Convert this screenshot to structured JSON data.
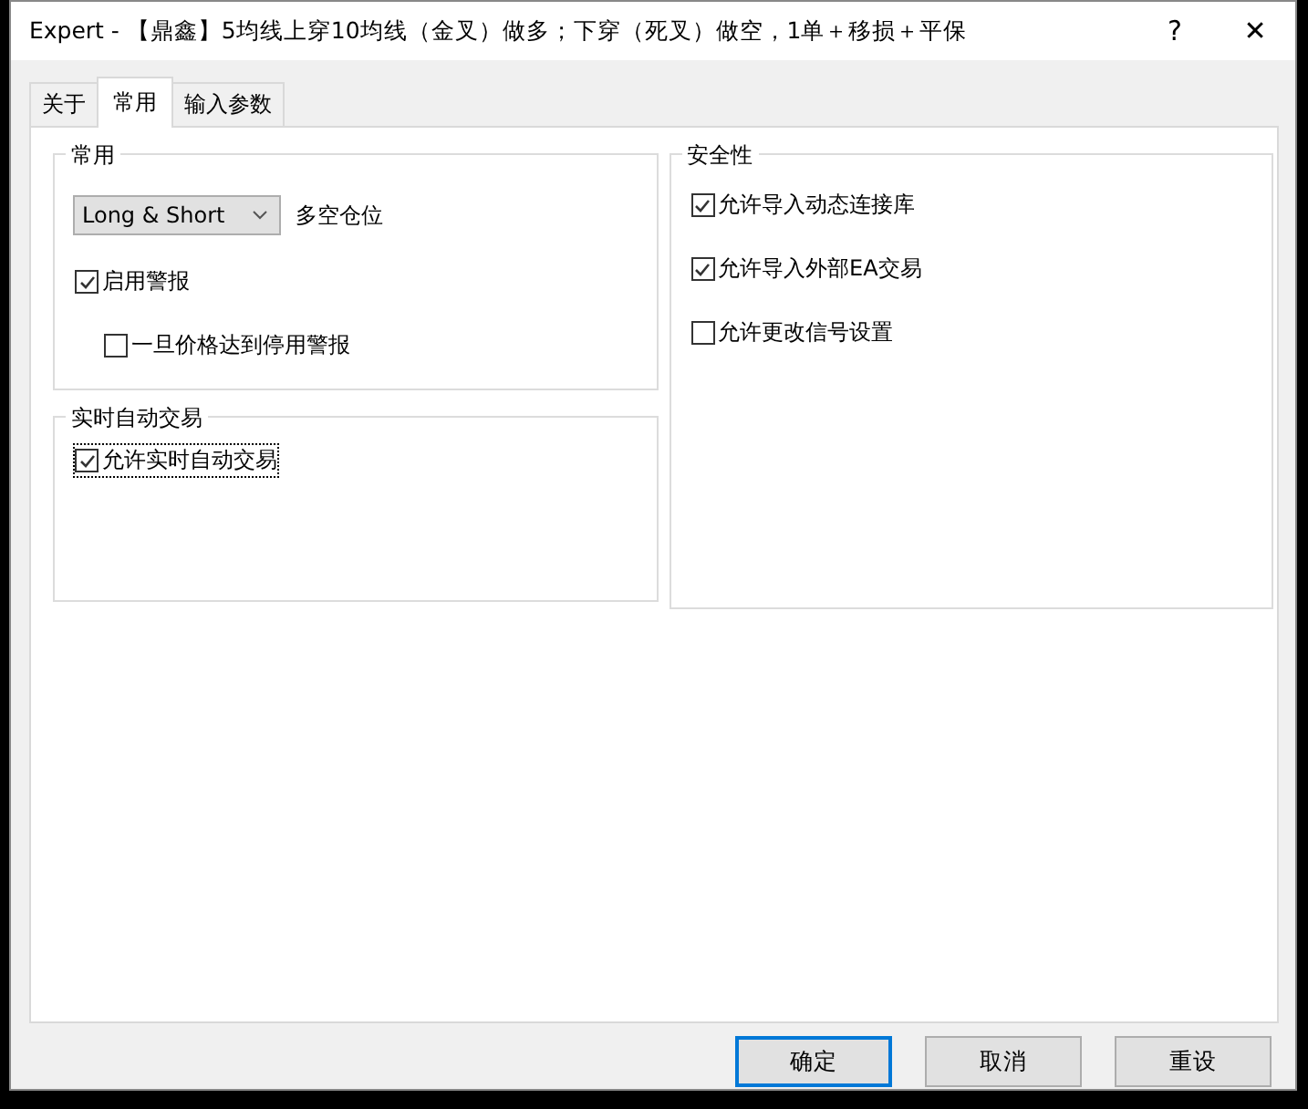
{
  "window": {
    "title": "Expert - 【鼎鑫】5均线上穿10均线（金叉）做多；下穿（死叉）做空，1单＋移损＋平保",
    "help": "?",
    "close": "✕"
  },
  "tabs": [
    {
      "label": "关于",
      "selected": false
    },
    {
      "label": "常用",
      "selected": true
    },
    {
      "label": "输入参数",
      "selected": false
    }
  ],
  "left_groups": [
    {
      "title": "常用",
      "items": [
        {
          "kind": "dropdown",
          "value": "Long & Short",
          "caption": "多空仓位"
        },
        {
          "kind": "checkbox",
          "label": "启用警报",
          "checked": true,
          "focused": false,
          "children": [
            {
              "kind": "checkbox",
              "label": "一旦价格达到停用警报",
              "checked": false,
              "focused": false
            }
          ]
        }
      ]
    },
    {
      "title": "实时自动交易",
      "items": [
        {
          "kind": "checkbox",
          "label": "允许实时自动交易",
          "checked": true,
          "focused": true
        }
      ]
    }
  ],
  "right_groups": [
    {
      "title": "安全性",
      "items": [
        {
          "kind": "checkbox",
          "label": "允许导入动态连接库",
          "checked": true,
          "focused": false
        },
        {
          "kind": "checkbox",
          "label": "允许导入外部EA交易",
          "checked": true,
          "focused": false
        },
        {
          "kind": "checkbox",
          "label": "允许更改信号设置",
          "checked": false,
          "focused": false
        }
      ]
    }
  ],
  "buttons": [
    {
      "label": "确定",
      "default": true
    },
    {
      "label": "取消",
      "default": false
    },
    {
      "label": "重设",
      "default": false
    }
  ]
}
